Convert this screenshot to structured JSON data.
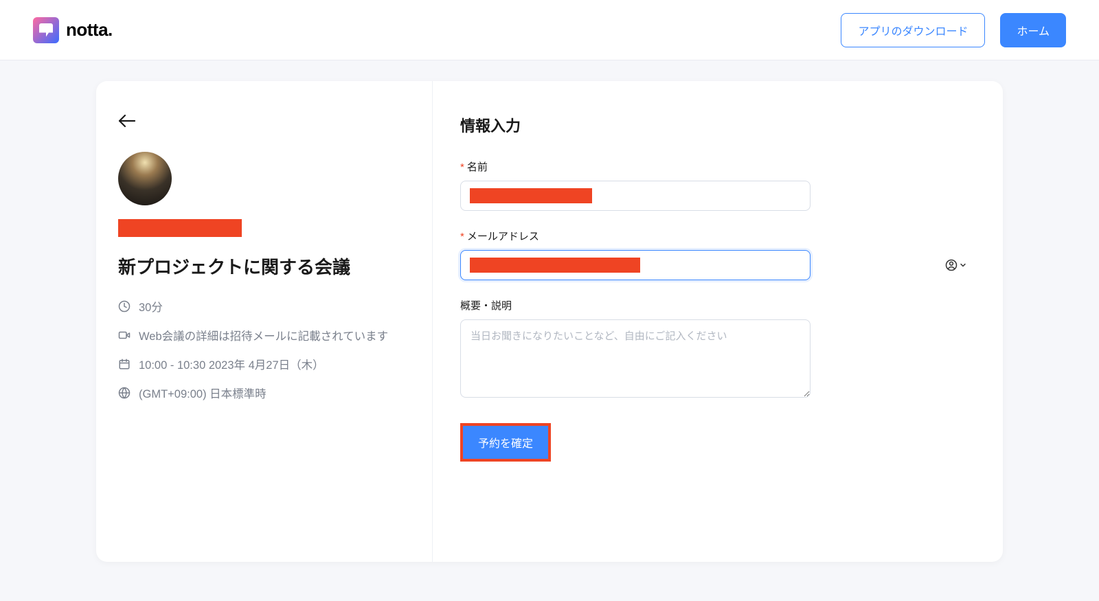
{
  "header": {
    "brand": "notta.",
    "download_label": "アプリのダウンロード",
    "home_label": "ホーム"
  },
  "event": {
    "title": "新プロジェクトに関する会議",
    "duration": "30分",
    "web_meeting_note": "Web会議の詳細は招待メールに記載されています",
    "datetime": "10:00 - 10:30 2023年 4月27日（木）",
    "timezone": "(GMT+09:00) 日本標準時"
  },
  "form": {
    "section_title": "情報入力",
    "name_label": "名前",
    "email_label": "メールアドレス",
    "desc_label": "概要・説明",
    "desc_placeholder": "当日お聞きになりたいことなど、自由にご記入ください",
    "submit_label": "予約を確定"
  }
}
